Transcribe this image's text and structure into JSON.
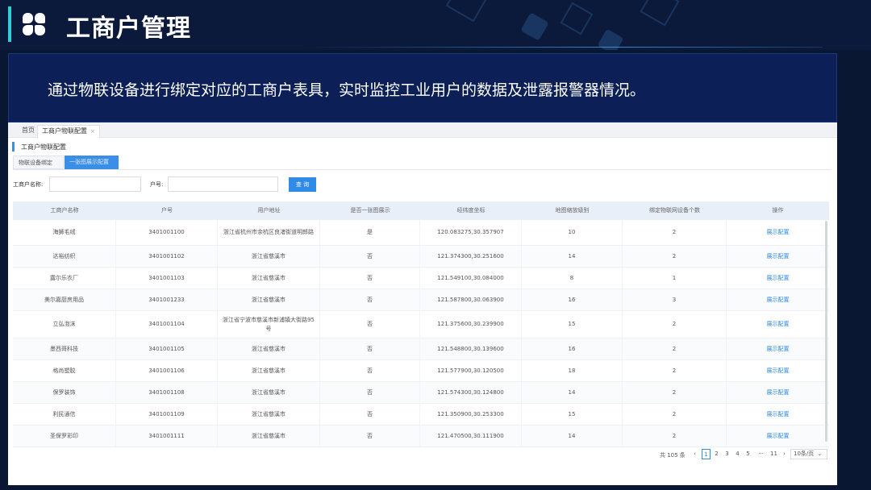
{
  "header": {
    "title": "工商户管理"
  },
  "description": "通过物联设备进行绑定对应的工商户表具，实时监控工业用户的数据及泄露报警器情况。",
  "app": {
    "tabs": [
      {
        "label": "首页"
      },
      {
        "label": "工商户物联配置",
        "close": "×"
      }
    ],
    "breadcrumb": "工商户物联配置",
    "subtabs": [
      {
        "label": "物联设备绑定"
      },
      {
        "label": "一张图展示配置"
      }
    ],
    "search": {
      "name_label": "工商户名称:",
      "name_value": "",
      "account_label": "户号:",
      "account_value": "",
      "button": "查 询"
    },
    "table": {
      "columns": [
        "工商户名称",
        "户号",
        "用户地址",
        "是否一张图展示",
        "经纬度坐标",
        "地图缩放级别",
        "绑定物联网设备个数",
        "操作"
      ],
      "rows": [
        {
          "name": "海狮毛绒",
          "account": "3401001100",
          "address": "浙江省杭州市余杭区良渚街道明郎路",
          "show": "是",
          "coord": "120.083275,30.357907",
          "zoom": "10",
          "devices": "2",
          "op": "展示配置"
        },
        {
          "name": "达裕纺织",
          "account": "3401001102",
          "address": "浙江省慈溪市",
          "show": "否",
          "coord": "121.374300,30.251600",
          "zoom": "14",
          "devices": "2",
          "op": "展示配置"
        },
        {
          "name": "露尔乐衣厂",
          "account": "3401001103",
          "address": "浙江省慈溪市",
          "show": "否",
          "coord": "121.549100,30.084000",
          "zoom": "8",
          "devices": "1",
          "op": "展示配置"
        },
        {
          "name": "美尔嘉厨房用品",
          "account": "3401001233",
          "address": "浙江省慈溪市",
          "show": "否",
          "coord": "121.587800,30.063900",
          "zoom": "16",
          "devices": "3",
          "op": "展示配置"
        },
        {
          "name": "立弘泡沫",
          "account": "3401001104",
          "address": "浙江省宁波市慈溪市新浦镇大街路95号",
          "show": "否",
          "coord": "121.375600,30.239900",
          "zoom": "15",
          "devices": "2",
          "op": "展示配置"
        },
        {
          "name": "墨西哥科技",
          "account": "3401001105",
          "address": "浙江省慈溪市",
          "show": "否",
          "coord": "121.548800,30.139600",
          "zoom": "16",
          "devices": "2",
          "op": "展示配置"
        },
        {
          "name": "格尚塑胶",
          "account": "3401001106",
          "address": "浙江省慈溪市",
          "show": "否",
          "coord": "121.577900,30.120500",
          "zoom": "18",
          "devices": "2",
          "op": "展示配置"
        },
        {
          "name": "保罗装饰",
          "account": "3401001108",
          "address": "浙江省慈溪市",
          "show": "否",
          "coord": "121.574300,30.124800",
          "zoom": "14",
          "devices": "2",
          "op": "展示配置"
        },
        {
          "name": "利民通信",
          "account": "3401001109",
          "address": "浙江省慈溪市",
          "show": "否",
          "coord": "121.350900,30.253300",
          "zoom": "15",
          "devices": "2",
          "op": "展示配置"
        },
        {
          "name": "圣保罗彩印",
          "account": "3401001111",
          "address": "浙江省慈溪市",
          "show": "否",
          "coord": "121.470500,30.111900",
          "zoom": "14",
          "devices": "2",
          "op": "展示配置"
        }
      ]
    },
    "pager": {
      "total": "共 105 条",
      "prev": "‹",
      "pages": [
        "1",
        "2",
        "3",
        "4",
        "5",
        "···",
        "11"
      ],
      "next": "›",
      "size": "10条/页",
      "size_arrow": "⌄",
      "current": "1"
    }
  },
  "colors": {
    "accent": "#2fd0d8",
    "primary": "#2f8ae8",
    "banner": "#0c1f56"
  }
}
